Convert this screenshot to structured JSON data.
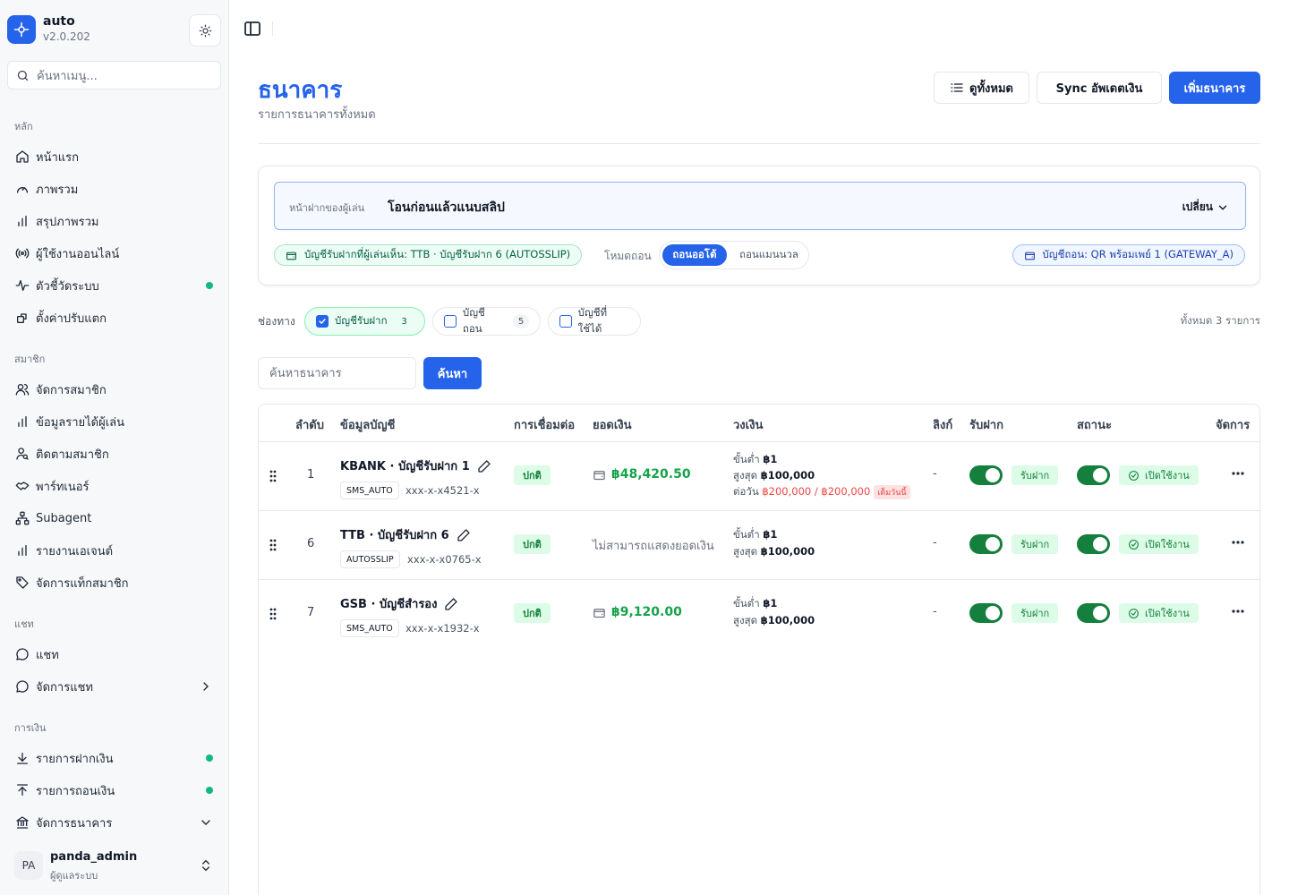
{
  "brand": {
    "name": "auto",
    "version": "v2.0.202"
  },
  "sidebar": {
    "search_placeholder": "ค้นหาเมนู...",
    "sections": {
      "main": "หลัก",
      "members": "สมาชิก",
      "chat": "แชท",
      "finance": "การเงิน"
    },
    "items": {
      "home": "หน้าแรก",
      "overview": "ภาพรวม",
      "summary": "สรุปภาพรวม",
      "online_users": "ผู้ใช้งานออนไลน์",
      "metrics": "ตัวชี้วัดระบบ",
      "adjust_settings": "ตั้งค่าปรับแตก",
      "manage_members": "จัดการสมาชิก",
      "player_income": "ข้อมูลรายได้ผู้เล่น",
      "follow_members": "ติดตามสมาชิก",
      "partner": "พาร์ทเนอร์",
      "subagent": "Subagent",
      "agent_report": "รายงานเอเจนต์",
      "member_tags": "จัดการแท็กสมาชิก",
      "chat": "แชท",
      "manage_chat": "จัดการแชท",
      "deposits": "รายการฝากเงิน",
      "withdrawals": "รายการถอนเงิน",
      "manage_banks": "จัดการธนาคาร"
    }
  },
  "user": {
    "initials": "PA",
    "name": "panda_admin",
    "role": "ผู้ดูแลระบบ"
  },
  "header": {
    "title": "ธนาคาร",
    "subtitle": "รายการธนาคารทั้งหมด",
    "view_all": "ดูทั้งหมด",
    "sync": "Sync อัพเดตเงิน",
    "add_bank": "เพิ่มธนาคาร"
  },
  "deposit_config": {
    "face_label": "หน้าฝากของผู้เล่น",
    "face_value": "โอนก่อนแล้วแนบสลิป",
    "change": "เปลี่ยน",
    "deposit_account": "บัญชีรับฝากที่ผู้เล่นเห็น: TTB · บัญชีรับฝาก 6 (AUTOSSLIP)",
    "withdraw_mode_label": "โหมดถอน",
    "mode_auto": "ถอนออโต้",
    "mode_manual": "ถอนแมนนวล",
    "withdraw_account": "บัญชีถอน: QR พร้อมเพย์ 1 (GATEWAY_A)"
  },
  "filters": {
    "channel_label": "ช่องทาง",
    "chips": [
      {
        "label": "บัญชีรับฝาก",
        "count": "3",
        "checked": true
      },
      {
        "label": "บัญชีถอน",
        "count": "5",
        "checked": false
      },
      {
        "label": "บัญชีที่ใช้ได้",
        "count": "",
        "checked": false
      }
    ],
    "total": "ทั้งหมด 3 รายการ",
    "search_placeholder": "ค้นหาธนาคาร",
    "search_button": "ค้นหา"
  },
  "table": {
    "headers": {
      "order": "ลำดับ",
      "account_info": "ข้อมูลบัญชี",
      "connection": "การเชื่อมต่อ",
      "balance": "ยอดเงิน",
      "limit": "วงเงิน",
      "link": "ลิงก์",
      "deposit": "รับฝาก",
      "status": "สถานะ",
      "actions": "จัดการ"
    },
    "labels": {
      "min": "ขั้นต่ำ",
      "max": "สูงสุด",
      "daily": "ต่อวัน",
      "full_today": "เต็มวันนี้",
      "deposit_badge": "รับฝาก",
      "enabled": "เปิดใช้งาน"
    },
    "rows": [
      {
        "order": "1",
        "name": "KBANK · บัญชีรับฝาก 1",
        "tag": "SMS_AUTO",
        "account_no": "xxx-x-x4521-x",
        "connection": "ปกติ",
        "balance": "฿48,420.50",
        "min": "฿1",
        "max": "฿100,000",
        "daily": "฿200,000 / ฿200,000",
        "link": "-"
      },
      {
        "order": "6",
        "name": "TTB · บัญชีรับฝาก 6",
        "tag": "AUTOSSLIP",
        "account_no": "xxx-x-x0765-x",
        "connection": "ปกติ",
        "balance_na": "ไม่สามารถแสดงยอดเงิน",
        "min": "฿1",
        "max": "฿100,000",
        "link": "-"
      },
      {
        "order": "7",
        "name": "GSB · บัญชีสำรอง",
        "tag": "SMS_AUTO",
        "account_no": "xxx-x-x1932-x",
        "connection": "ปกติ",
        "balance": "฿9,120.00",
        "min": "฿1",
        "max": "฿100,000",
        "link": "-"
      }
    ]
  }
}
